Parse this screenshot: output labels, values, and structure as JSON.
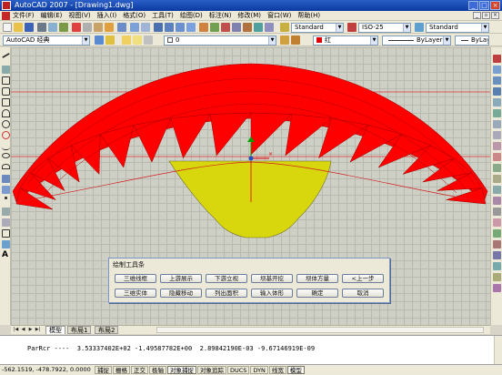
{
  "window": {
    "title": "AutoCAD 2007 - [Drawing1.dwg]"
  },
  "menu": [
    "文件(F)",
    "编辑(E)",
    "视图(V)",
    "插入(I)",
    "格式(O)",
    "工具(T)",
    "绘图(D)",
    "标注(N)",
    "修改(M)",
    "窗口(W)",
    "帮助(H)"
  ],
  "toolbar1": {
    "textstyle": "Standard",
    "dimstyle": "ISO-25",
    "tablestyle": "Standard"
  },
  "toolbar2": {
    "workspace": "AutoCAD 经典",
    "layer": "0",
    "color": "红",
    "linetype": "ByLayer",
    "lineweight": "ByLayer"
  },
  "dialog": {
    "title": "绘制工具条",
    "row1": [
      "三维线框",
      "上游展示",
      "下游立视",
      "坝基开挖",
      "坝体方量",
      "<上一步"
    ],
    "row2": [
      "三维实体",
      "隐藏移动",
      "列出面积",
      "输入体形",
      "确定",
      "取消"
    ]
  },
  "tabs": {
    "model": "模型",
    "layout1": "布局1",
    "layout2": "布局2"
  },
  "command": {
    "line": "ParRcr ----  3.53337402E+02 -1.49587782E+00  2.89842190E-03 -9.67146919E-09"
  },
  "status": {
    "coords": "-562.1519, -478.7922, 0.0000",
    "modes": [
      "捕捉",
      "栅格",
      "正交",
      "极轴",
      "对象捕捉",
      "对象追踪",
      "DUCS",
      "DYN",
      "线宽",
      "模型"
    ]
  },
  "colors": {
    "arch_fill": "#ff0000",
    "foundation_fill": "#d8d60c",
    "axis_x": "#e00000",
    "axis_y": "#00a000"
  }
}
